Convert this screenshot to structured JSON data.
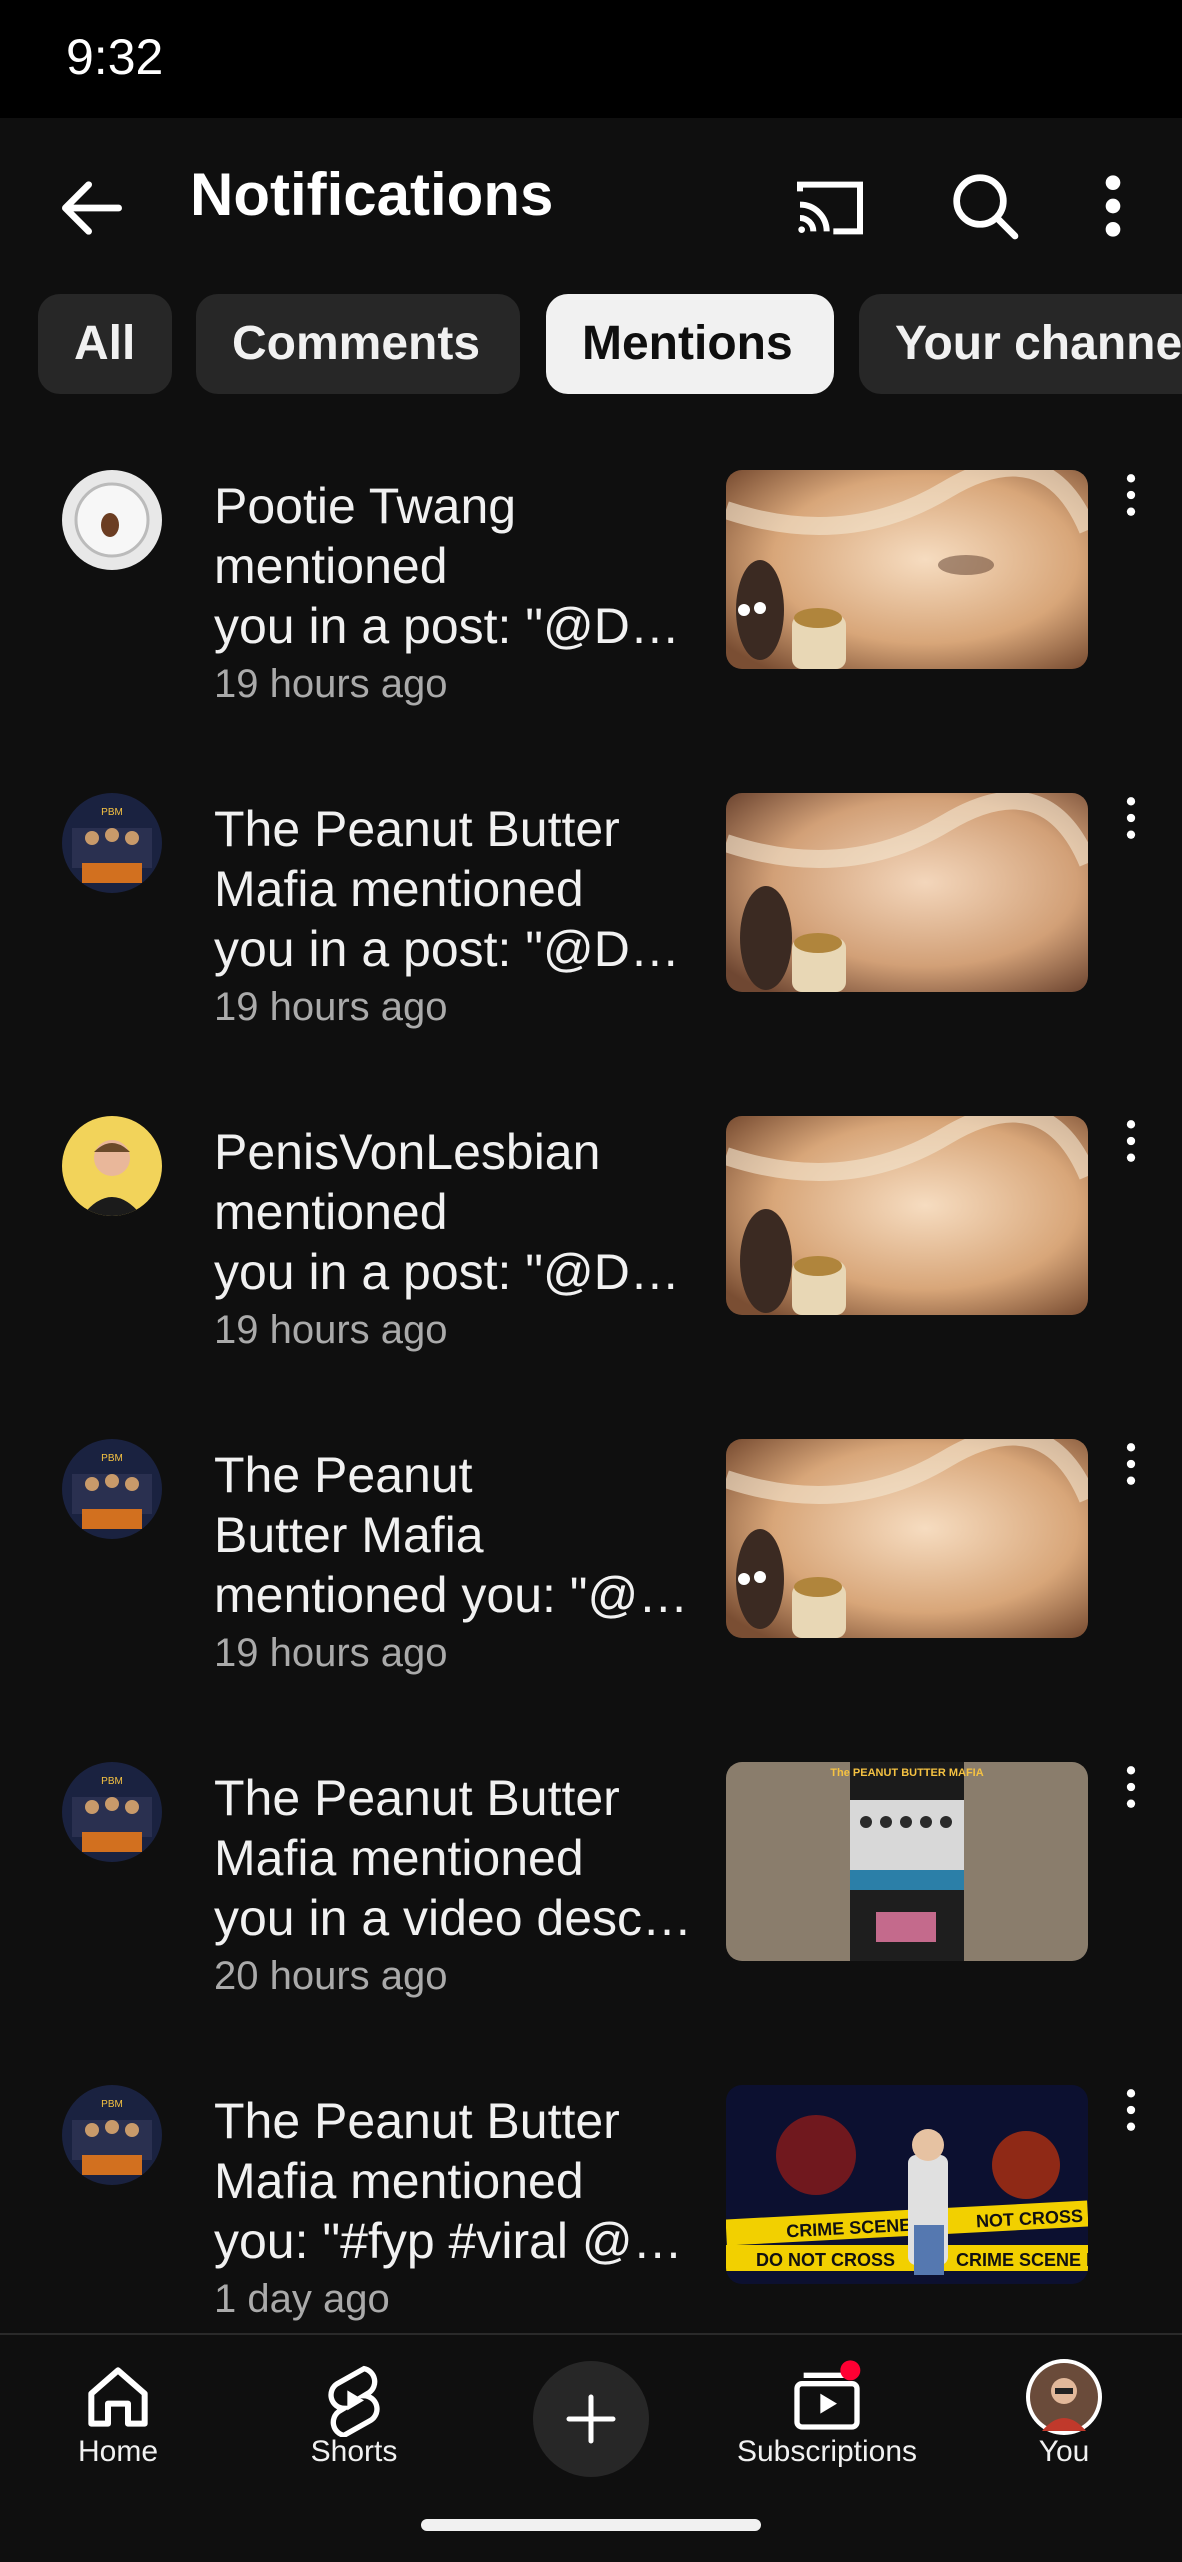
{
  "status_bar": {
    "time": "9:32"
  },
  "header": {
    "title": "Notifications"
  },
  "icons": {
    "back": "arrow-left-icon",
    "cast": "cast-icon",
    "search": "search-icon",
    "more": "more-vert-icon"
  },
  "filters": [
    {
      "label": "All",
      "selected": false
    },
    {
      "label": "Comments",
      "selected": false
    },
    {
      "label": "Mentions",
      "selected": true
    },
    {
      "label": "Your channe",
      "selected": false
    }
  ],
  "notifications": [
    {
      "line1": "Pootie Twang",
      "line2": "mentioned",
      "line3": "you in a post: \"@Da…",
      "time": "19 hours ago"
    },
    {
      "line1": "The Peanut Butter",
      "line2": "Mafia mentioned",
      "line3": "you in a post: \"@Da…",
      "time": "19 hours ago"
    },
    {
      "line1": "PenisVonLesbian",
      "line2": "mentioned",
      "line3": "you in a post: \"@Da…",
      "time": "19 hours ago"
    },
    {
      "line1": "The Peanut",
      "line2": "Butter Mafia",
      "line3": "mentioned you: \"@…",
      "time": "19 hours ago"
    },
    {
      "line1": "The Peanut Butter",
      "line2": "Mafia mentioned",
      "line3": "you in a video desc…",
      "time": "20 hours ago"
    },
    {
      "line1": "The Peanut Butter",
      "line2": "Mafia mentioned",
      "line3": "you: \"#fyp #viral @…",
      "time": "1 day ago"
    }
  ],
  "thumb_text": {
    "pbm_title": "The PEANUT BUTTER MAFIA",
    "tape1": "CRIME SCENE",
    "tape2": "NOT CROSS",
    "tape3": "DO NOT CROSS",
    "tape4": "CRIME SCENE DO"
  },
  "bottom_nav": {
    "home": "Home",
    "shorts": "Shorts",
    "subscriptions": "Subscriptions",
    "you": "You"
  },
  "colors": {
    "background": "#0f0f0f",
    "chip": "#272727",
    "chip_active": "#f1f1f1",
    "secondary_text": "#aaaaaa",
    "badge": "#ff0033"
  }
}
